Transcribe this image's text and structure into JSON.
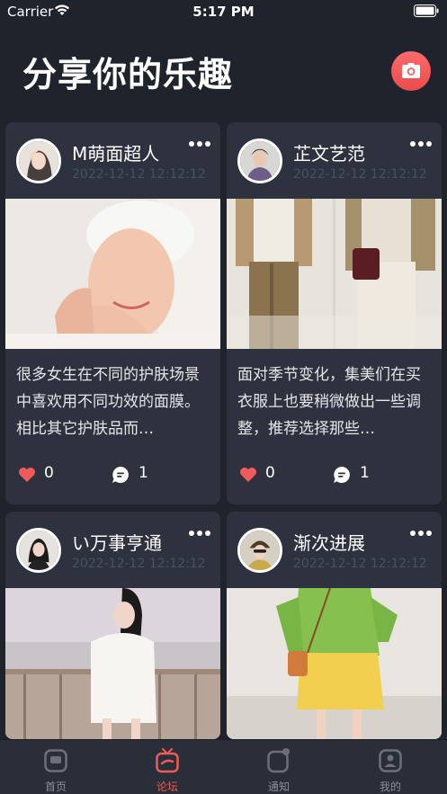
{
  "status_bar": {
    "carrier": "Carrier",
    "time": "5:17 PM"
  },
  "header": {
    "title": "分享你的乐趣"
  },
  "posts": [
    {
      "username": "M萌面超人",
      "timestamp": "2022-12-12 12:12:12",
      "description": "很多女生在不同的护肤场景中喜欢用不同功效的面膜。相比其它护肤品而…",
      "likes": "0",
      "comments": "1"
    },
    {
      "username": "芷文艺范",
      "timestamp": "2022-12-12 12:12:12",
      "description": "面对季节变化，集美们在买衣服上也要稍微做出一些调整，推荐选择那些…",
      "likes": "0",
      "comments": "1"
    },
    {
      "username": "い万事亨通",
      "timestamp": "2022-12-12 12:12:12"
    },
    {
      "username": "渐次进展",
      "timestamp": "2022-12-12 12:12:12"
    }
  ],
  "tabs": [
    {
      "label": "首页",
      "icon": "home-icon"
    },
    {
      "label": "论坛",
      "icon": "forum-icon"
    },
    {
      "label": "通知",
      "icon": "notification-icon"
    },
    {
      "label": "我的",
      "icon": "profile-icon"
    }
  ],
  "colors": {
    "accent": "#ef5a5a",
    "background": "#1f232c",
    "card": "#2d323e"
  }
}
